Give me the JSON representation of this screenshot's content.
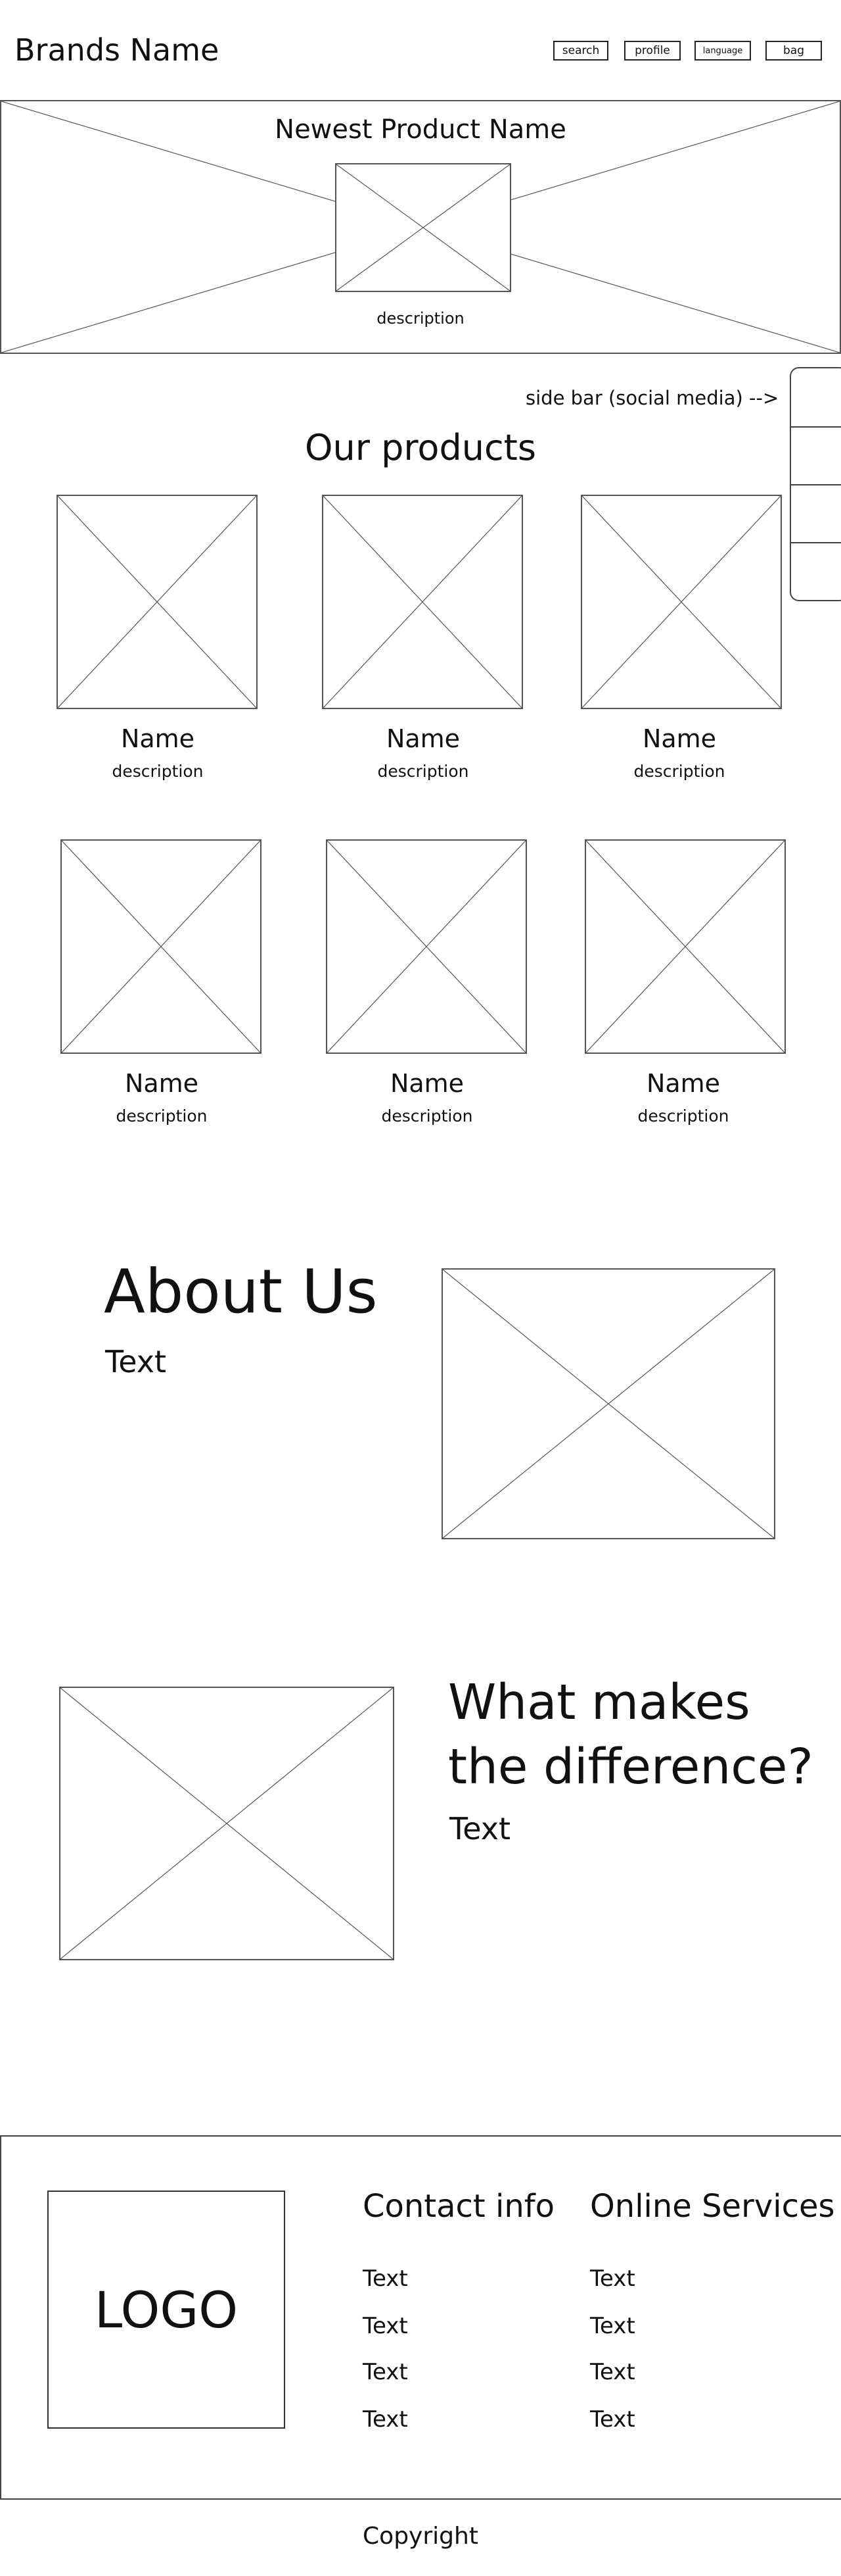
{
  "header": {
    "brand": "Brands Name",
    "nav": {
      "search": "search",
      "profile": "profile",
      "language": "language",
      "bag": "bag"
    }
  },
  "hero": {
    "title": "Newest Product Name",
    "description": "description"
  },
  "sidebar": {
    "label": "side bar (social media) -->",
    "items_count": 4
  },
  "products": {
    "heading": "Our products",
    "items": [
      {
        "name": "Name",
        "description": "description"
      },
      {
        "name": "Name",
        "description": "description"
      },
      {
        "name": "Name",
        "description": "description"
      },
      {
        "name": "Name",
        "description": "description"
      },
      {
        "name": "Name",
        "description": "description"
      },
      {
        "name": "Name",
        "description": "description"
      }
    ]
  },
  "about": {
    "heading": "About Us",
    "text": "Text"
  },
  "difference": {
    "heading_line1": "What makes",
    "heading_line2": "the difference?",
    "text": "Text"
  },
  "footer": {
    "logo": "LOGO",
    "contact": {
      "heading": "Contact info",
      "items": [
        "Text",
        "Text",
        "Text",
        "Text"
      ]
    },
    "services": {
      "heading": "Online Services",
      "items": [
        "Text",
        "Text",
        "Text",
        "Text"
      ]
    },
    "copyright": "Copyright"
  }
}
